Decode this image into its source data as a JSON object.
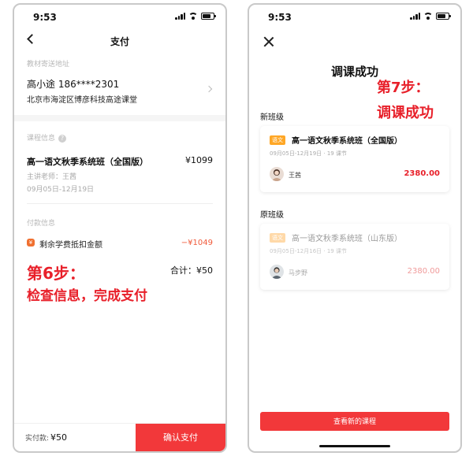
{
  "left": {
    "status_time": "9:53",
    "nav_title": "支付",
    "address": {
      "section_label": "教材寄送地址",
      "name_phone": "高小途   186****2301",
      "line": "北京市海淀区博彦科技高途课堂"
    },
    "course": {
      "section_label": "课程信息",
      "help_glyph": "?",
      "name": "高一语文秋季系统班（全国版）",
      "price": "¥1099",
      "teacher": "主讲老师：王茜",
      "dates": "09月05日-12月19日"
    },
    "payment": {
      "section_label": "付款信息",
      "coin_glyph": "¥",
      "deduct_label": "剩余学费抵扣金额",
      "deduct_amount": "−¥1049",
      "total": "合计：¥50"
    },
    "step": {
      "line1": "第6步：",
      "line2": "检查信息，完成支付"
    },
    "pay_bar": {
      "due_label": "实付款:",
      "due_amount": "¥50",
      "confirm_label": "确认支付"
    }
  },
  "right": {
    "status_time": "9:53",
    "title": "调课成功",
    "step": {
      "line1": "第7步：",
      "line2": "调课成功"
    },
    "new_class": {
      "heading": "新班级",
      "tag": "语文",
      "name": "高一语文秋季系统班（全国版）",
      "meta": "09月05日-12月19日 · 19 课节",
      "teacher": "王茜",
      "price": "2380.00"
    },
    "old_class": {
      "heading": "原班级",
      "tag": "语文",
      "name": "高一语文秋季系统班（山东版）",
      "meta": "09月05日-12月16日 · 19 课节",
      "teacher": "马步野",
      "price": "2380.00"
    },
    "view_button_label": "查看新的课程"
  },
  "colors": {
    "accent_red": "#f2383a",
    "step_red": "#e8202a",
    "tag_orange": "#ffa726"
  }
}
